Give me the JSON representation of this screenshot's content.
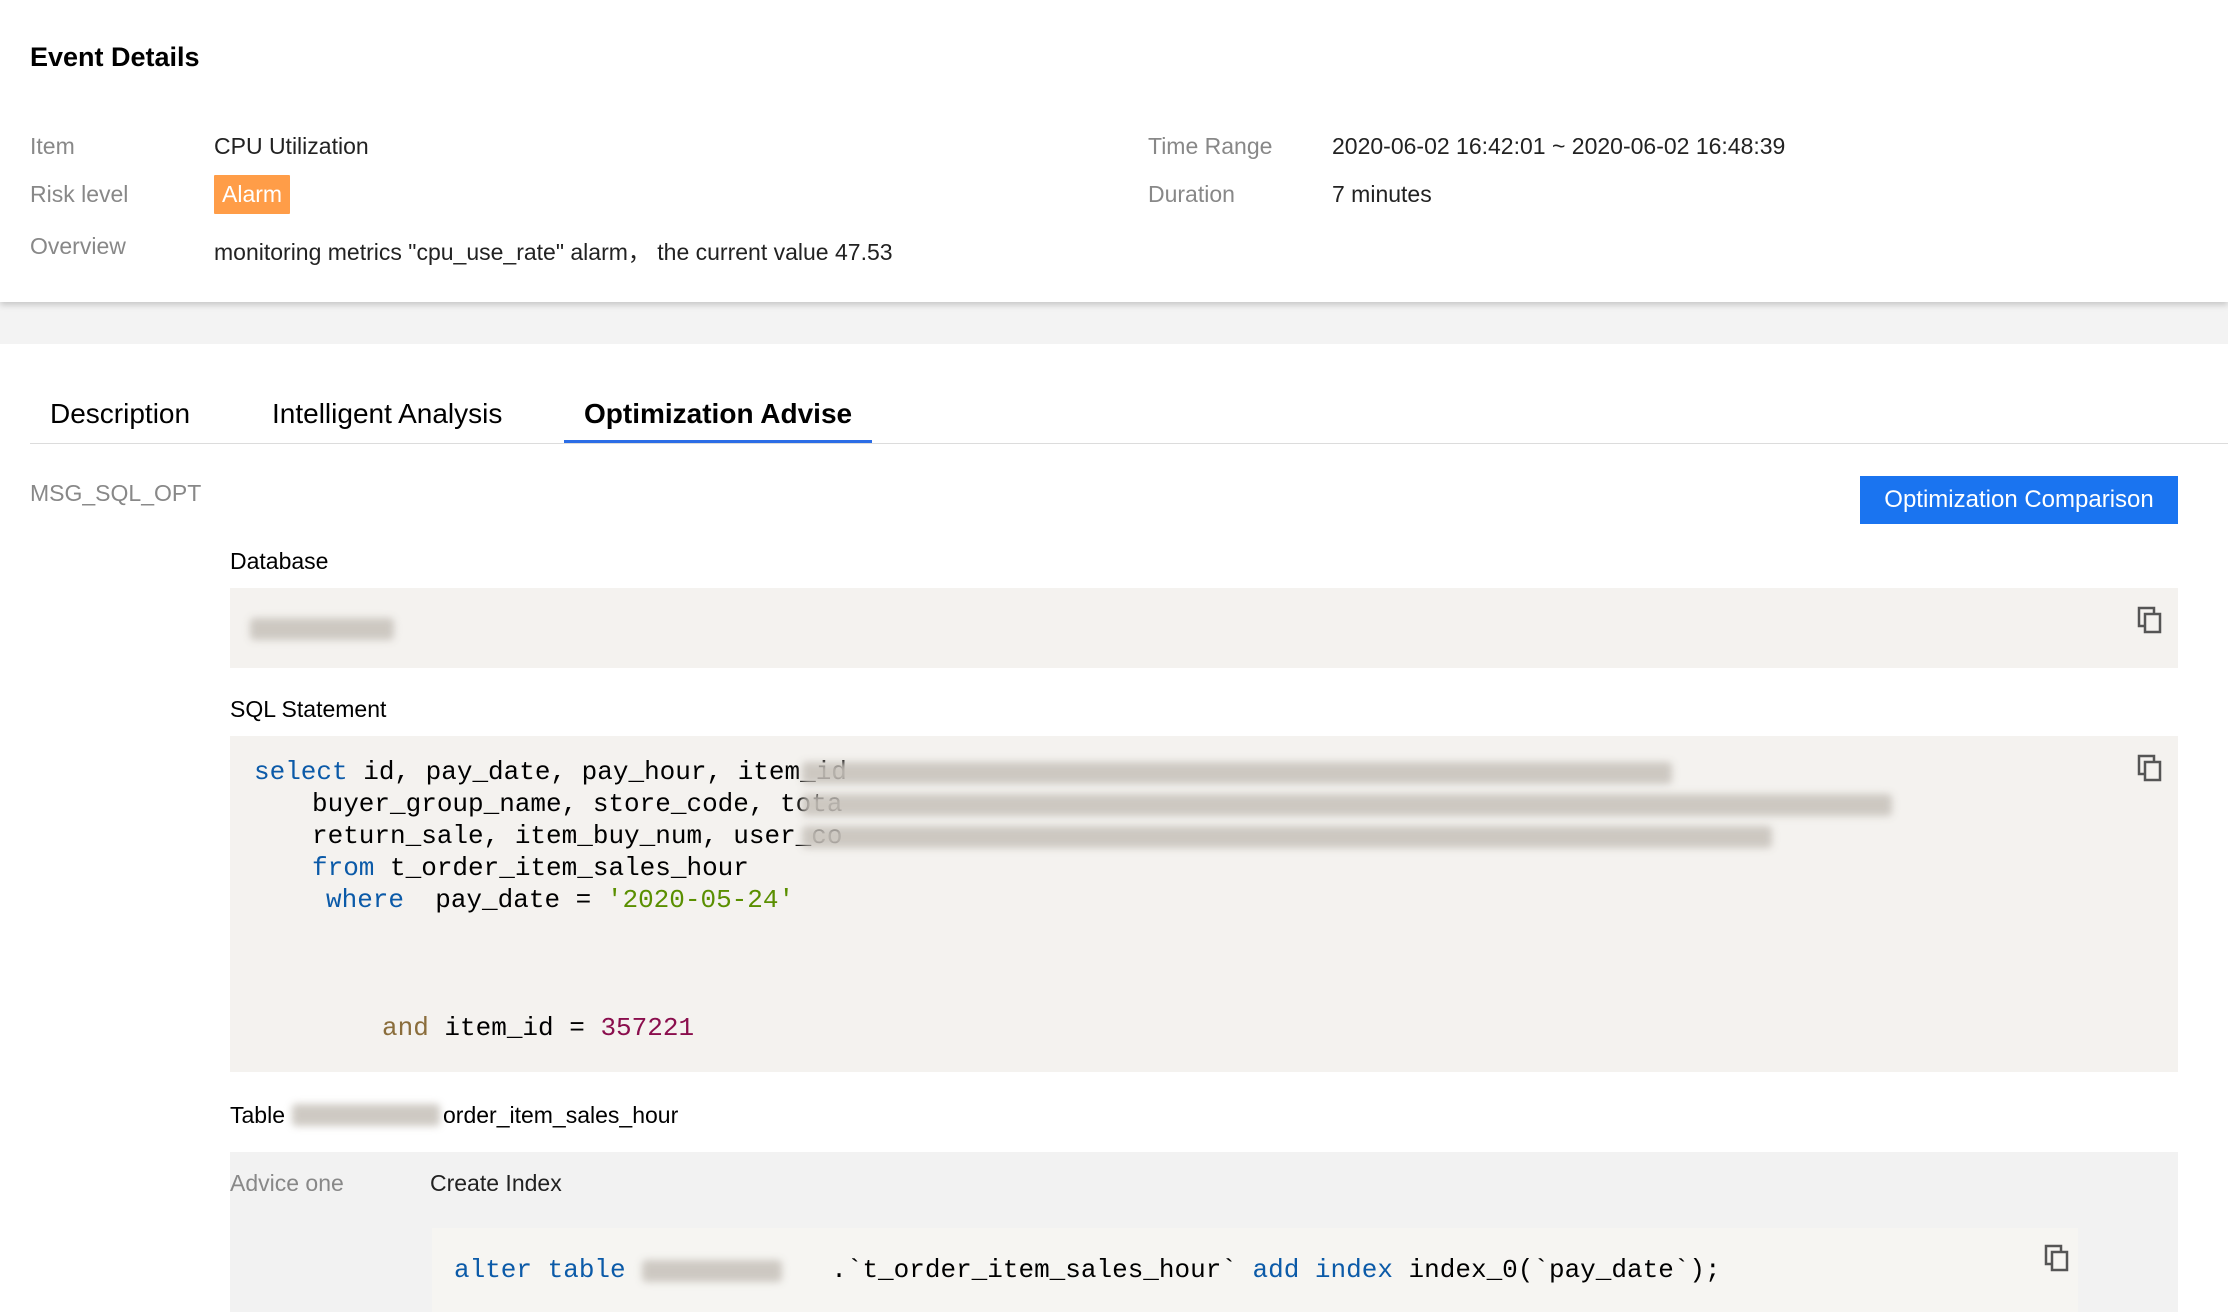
{
  "header": {
    "title": "Event Details"
  },
  "details": {
    "item_label": "Item",
    "item_value": "CPU Utilization",
    "risk_label": "Risk level",
    "risk_value": "Alarm",
    "overview_label": "Overview",
    "overview_value": "monitoring metrics \"cpu_use_rate\" alarm， the current value 47.53",
    "time_range_label": "Time Range",
    "time_range_value": "2020-06-02 16:42:01 ~ 2020-06-02 16:48:39",
    "duration_label": "Duration",
    "duration_value": "7 minutes"
  },
  "tabs": [
    {
      "label": "Description",
      "active": false
    },
    {
      "label": "Intelligent Analysis",
      "active": false
    },
    {
      "label": "Optimization Advise",
      "active": true
    }
  ],
  "content": {
    "message_code": "MSG_SQL_OPT",
    "comparison_button": "Optimization Comparison",
    "database_label": "Database",
    "sql_label": "SQL Statement",
    "sql": {
      "l1_kw": "select",
      "l1_text": " id, pay_date, pay_hour, item_id",
      "l2_text": "buyer_group_name, store_code, tota",
      "l3_text": "return_sale, item_buy_num, user_co",
      "l4_kw": "from",
      "l4_text": " t_order_item_sales_hour",
      "l5_kw": "where",
      "l5_text": "  pay_date = ",
      "l5_str": "'2020-05-24'",
      "l6_kw": "and",
      "l6_text": " item_id = ",
      "l6_num": "357221"
    },
    "table_label": "Table",
    "table_suffix": "order_item_sales_hour",
    "advice": {
      "label": "Advice one",
      "title": "Create Index",
      "code_kw1": "alter table",
      "code_mid": " .`t_order_item_sales_hour` ",
      "code_kw2": "add index",
      "code_tail": " index_0(`pay_date`);"
    }
  },
  "icons": {
    "copy": "copy-icon"
  },
  "colors": {
    "accent": "#1a74f0",
    "alarm": "#ff9d48",
    "tab_underline": "#2b6de6"
  }
}
